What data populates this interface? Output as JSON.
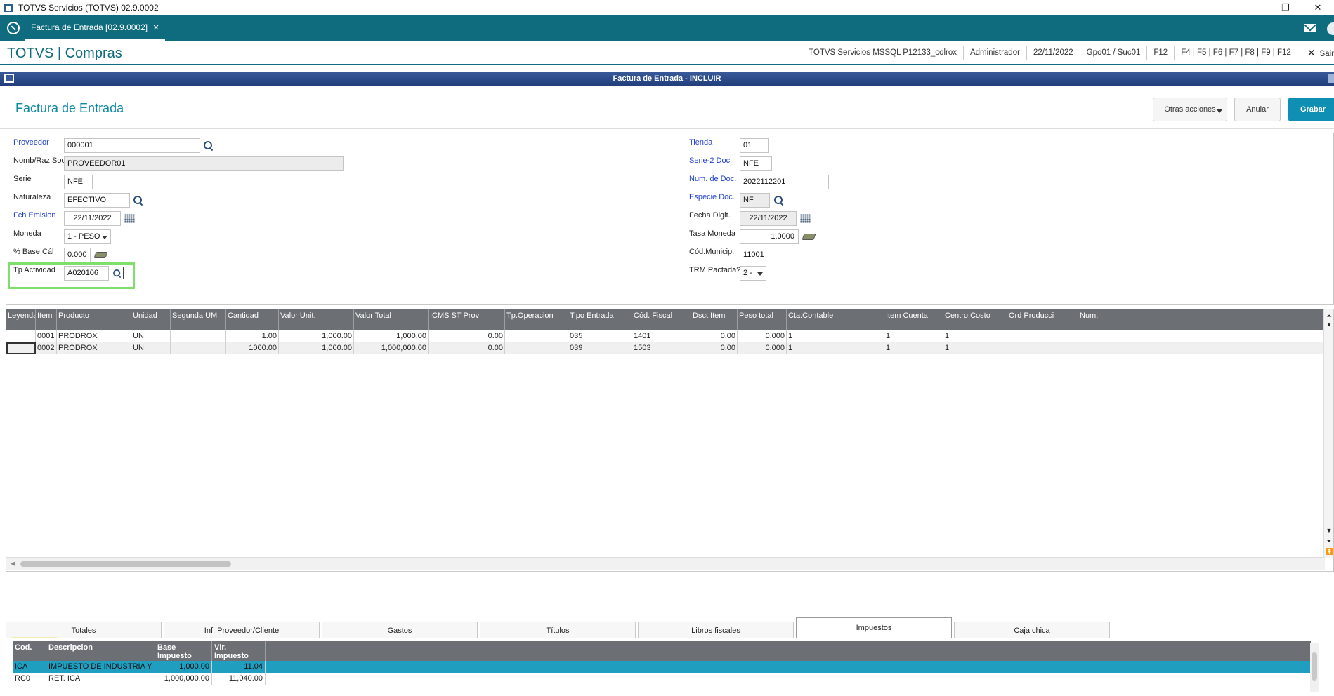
{
  "window": {
    "title": "TOTVS Servicios (TOTVS) 02.9.0002",
    "controls": [
      "–",
      "❐",
      "✕"
    ]
  },
  "tabstrip": {
    "tab_label": "Factura de Entrada [02.9.0002]",
    "tab_close": "✕"
  },
  "header": {
    "brand": "TOTVS | Compras",
    "server": "TOTVS Servicios MSSQL P12133_colrox",
    "user": "Administrador",
    "date": "22/11/2022",
    "branch": "Gpo01 / Suc01",
    "help_key": "F12",
    "fkeys": "F4 | F5 | F6 | F7 | F8 | F9 | F12",
    "exit_icon": "✕",
    "exit_label": "Sair"
  },
  "dialog": {
    "caption": "Factura de Entrada - INCLUIR"
  },
  "form": {
    "title": "Factura de Entrada",
    "buttons": {
      "otras": "Otras acciones",
      "anular": "Anular",
      "grabar": "Grabar"
    },
    "left": {
      "proveedor_label": "Proveedor",
      "proveedor": "000001",
      "nomb_label": "Nomb/Raz.Soc",
      "nomb": "PROVEEDOR01",
      "serie_label": "Serie",
      "serie": "NFE",
      "naturaleza_label": "Naturaleza",
      "naturaleza": "EFECTIVO",
      "fch_label": "Fch Emision",
      "fch": "22/11/2022",
      "moneda_label": "Moneda",
      "moneda": "1 - PESO",
      "base_label": "% Base Cál",
      "base": "0.000",
      "tp_label": "Tp Actividad",
      "tp": "A020106"
    },
    "right": {
      "tienda_label": "Tienda",
      "tienda": "01",
      "serie2_label": "Serie-2 Doc",
      "serie2": "NFE",
      "num_label": "Num. de Doc.",
      "num": "2022112201",
      "especie_label": "Especie Doc.",
      "especie": "NF",
      "fdig_label": "Fecha Digit.",
      "fdig": "22/11/2022",
      "tasa_label": "Tasa Moneda",
      "tasa": "1.0000",
      "codmun_label": "Cód.Municip.",
      "codmun": "11001",
      "trm_label": "TRM Pactada?",
      "trm": "2 -"
    }
  },
  "grid": {
    "columns": [
      "Leyenda",
      "Item",
      "Producto",
      "Unidad",
      "Segunda UM",
      "Cantidad",
      "Valor Unit.",
      "Valor Total",
      "ICMS ST Prov",
      "Tp.Operacion",
      "Tipo Entrada",
      "Cód. Fiscal",
      "Dsct.Item",
      "Peso total",
      "Cta.Contable",
      "Item Cuenta",
      "Centro Costo",
      "Ord Producci",
      "Num."
    ],
    "rows": [
      [
        "",
        "0001",
        "PRODROX",
        "UN",
        "",
        "1.00",
        "1,000.00",
        "1,000.00",
        "0.00",
        "",
        "035",
        "1401",
        "0.00",
        "0.000",
        "1",
        "1",
        "1",
        "",
        ""
      ],
      [
        "",
        "0002",
        "PRODROX",
        "UN",
        "",
        "1000.00",
        "1,000.00",
        "1,000,000.00",
        "0.00",
        "",
        "039",
        "1503",
        "0.00",
        "0.000",
        "1",
        "1",
        "1",
        "",
        ""
      ]
    ]
  },
  "folders": {
    "tabs": [
      "Totales",
      "Inf. Proveedor/Cliente",
      "Gastos",
      "Títulos",
      "Libros fiscales",
      "Impuestos",
      "Caja chica"
    ],
    "active": "Impuestos"
  },
  "taxes": {
    "columns": [
      "Cod.",
      "Descripcion",
      "Base Impuesto",
      "Vlr. Impuesto"
    ],
    "rows": [
      [
        "ICA",
        "IMPUESTO DE INDUSTRIA Y COMERC",
        "1,000.00",
        "11.04"
      ],
      [
        "RC0",
        "RET. ICA",
        "1,000,000.00",
        "11,040.00"
      ]
    ]
  }
}
